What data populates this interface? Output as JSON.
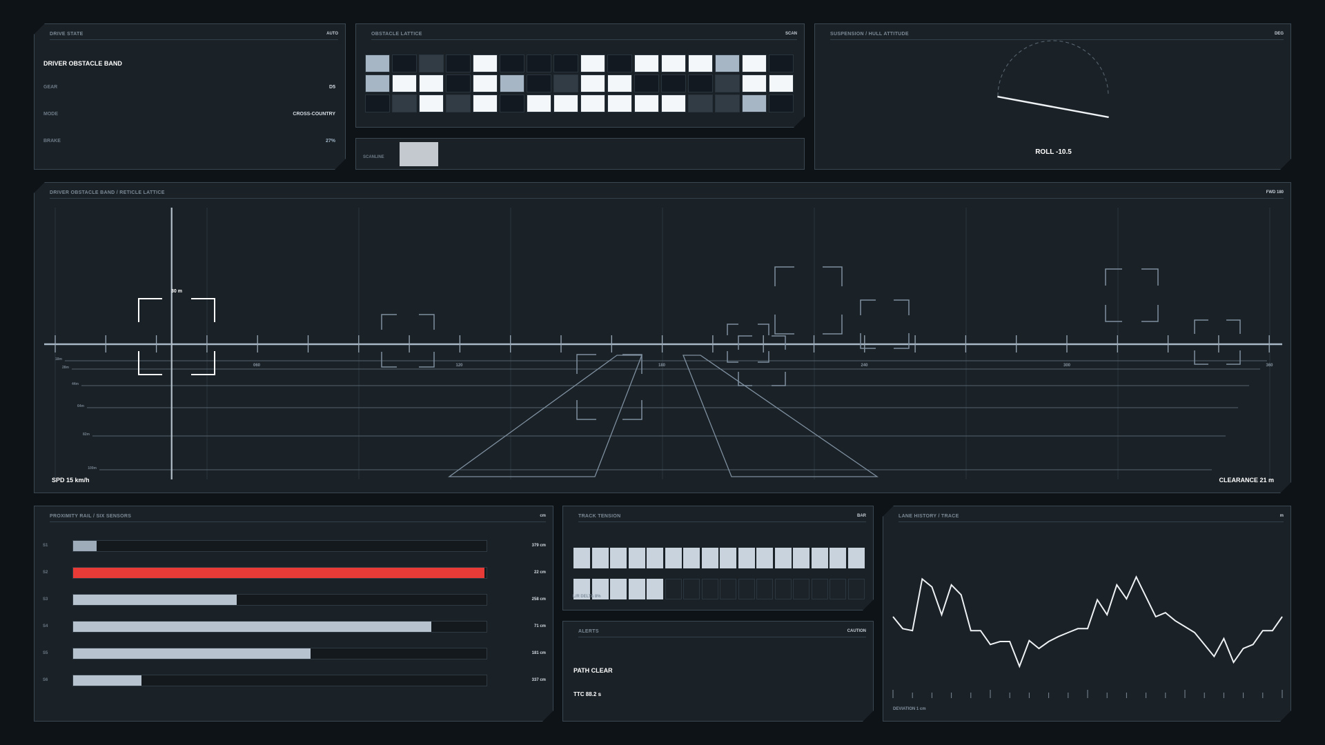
{
  "drive_state": {
    "title": "DRIVE STATE",
    "tag": "AUTO",
    "heading": "DRIVER OBSTACLE BAND",
    "rows": [
      {
        "label": "GEAR",
        "value": "D5"
      },
      {
        "label": "MODE",
        "value": "CROSS-COUNTRY"
      },
      {
        "label": "BRAKE",
        "value": "27%"
      }
    ]
  },
  "obstacle_lattice": {
    "title": "OBSTACLE LATTICE",
    "tag": "SCAN",
    "grid": [
      [
        2,
        0,
        1,
        0,
        3,
        0,
        0,
        0,
        3,
        0,
        3,
        3,
        3,
        2,
        3,
        0
      ],
      [
        2,
        3,
        3,
        0,
        3,
        2,
        0,
        1,
        3,
        3,
        0,
        0,
        0,
        1,
        3,
        3
      ],
      [
        0,
        1,
        3,
        1,
        3,
        0,
        3,
        3,
        3,
        3,
        3,
        3,
        1,
        1,
        2,
        0
      ]
    ],
    "colors": [
      "#131920",
      "#323c45",
      "#a7b6c4",
      "#f4f7fa"
    ]
  },
  "scanline": {
    "label": "SCANLINE"
  },
  "suspension": {
    "title": "SUSPENSION / HULL ATTITUDE",
    "tag": "DEG",
    "roll_text": "ROLL -10.5",
    "roll_deg": -10.5
  },
  "main": {
    "title": "DRIVER OBSTACLE BAND / RETICLE LATTICE",
    "tag": "FWD 180",
    "reticle_label": "30 m",
    "ticks": [
      "060",
      "120",
      "180",
      "240",
      "300",
      "360"
    ],
    "ranges": [
      "18m",
      "28m",
      "44m",
      "64m",
      "82m",
      "100m"
    ],
    "speed": "SPD 15 km/h",
    "clearance": "CLEARANCE 21 m"
  },
  "proximity": {
    "title": "PROXIMITY RAIL / SIX SENSORS",
    "tag": "cm",
    "sensors": [
      {
        "label": "S1",
        "value": "379 cm",
        "fill": 0.057,
        "alert": false
      },
      {
        "label": "S2",
        "value": "22 cm",
        "fill": 0.995,
        "alert": true
      },
      {
        "label": "S3",
        "value": "258 cm",
        "fill": 0.395,
        "alert": false
      },
      {
        "label": "S4",
        "value": "71 cm",
        "fill": 0.866,
        "alert": false
      },
      {
        "label": "S5",
        "value": "181 cm",
        "fill": 0.574,
        "alert": false
      },
      {
        "label": "S6",
        "value": "337 cm",
        "fill": 0.165,
        "alert": false
      }
    ]
  },
  "track_tension": {
    "title": "TRACK TENSION",
    "tag": "BAR",
    "left_filled": 16,
    "right_filled": 5,
    "cells_per_row": 16,
    "note": "L/R DELTA 8%"
  },
  "alerts": {
    "title": "ALERTS",
    "tag": "CAUTION",
    "status": "PATH CLEAR",
    "ttc": "TTC 88.2 s"
  },
  "lane_history": {
    "title": "LANE HISTORY / TRACE",
    "tag": "m",
    "footer": "DEVIATION 1 cm",
    "trace": [
      0.5,
      0.62,
      0.64,
      0.12,
      0.2,
      0.48,
      0.18,
      0.28,
      0.64,
      0.64,
      0.78,
      0.75,
      0.75,
      1.0,
      0.74,
      0.82,
      0.75,
      0.7,
      0.66,
      0.62,
      0.62,
      0.33,
      0.48,
      0.18,
      0.32,
      0.1,
      0.3,
      0.5,
      0.46,
      0.54,
      0.6,
      0.66,
      0.78,
      0.9,
      0.72,
      0.96,
      0.82,
      0.78,
      0.64,
      0.64,
      0.5
    ]
  }
}
